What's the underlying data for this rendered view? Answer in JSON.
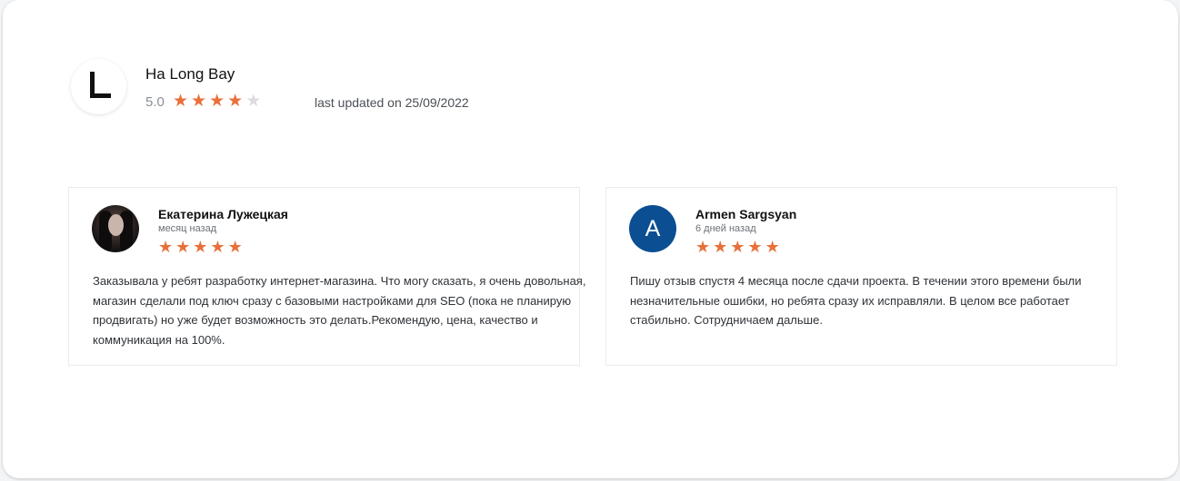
{
  "company": {
    "name": "Ha Long Bay",
    "rating": "5.0",
    "stars": {
      "filled": 4,
      "total": 5
    },
    "updated": "last updated on 25/09/2022"
  },
  "reviews": [
    {
      "author": "Екатерина Лужецкая",
      "date": "месяц назад",
      "stars": 5,
      "avatar": "photo",
      "text": "Заказывала у ребят разработку интернет-магазина. Что могу сказать, я очень довольная, магазин сделали под ключ сразу с базовыми настройками для SEO (пока не планирую продвигать) но уже будет возможность это делать.Рекомендую, цена, качество и коммуникация на 100%."
    },
    {
      "author": "Armen Sargsyan",
      "date": "6 дней назад",
      "stars": 5,
      "avatar_letter": "A",
      "text": "Пишу отзыв спустя 4 месяца после сдачи проекта. В течении этого времени были незначительные ошибки, но ребята сразу их исправляли. В целом все работает стабильно. Сотрудничаем дальше."
    }
  ],
  "colors": {
    "star": "#e8703a",
    "star_off": "#dcdcdc",
    "avatar_blue": "#0b4f92"
  },
  "icons": {
    "star": "star-icon",
    "logo": "company-logo-l"
  }
}
